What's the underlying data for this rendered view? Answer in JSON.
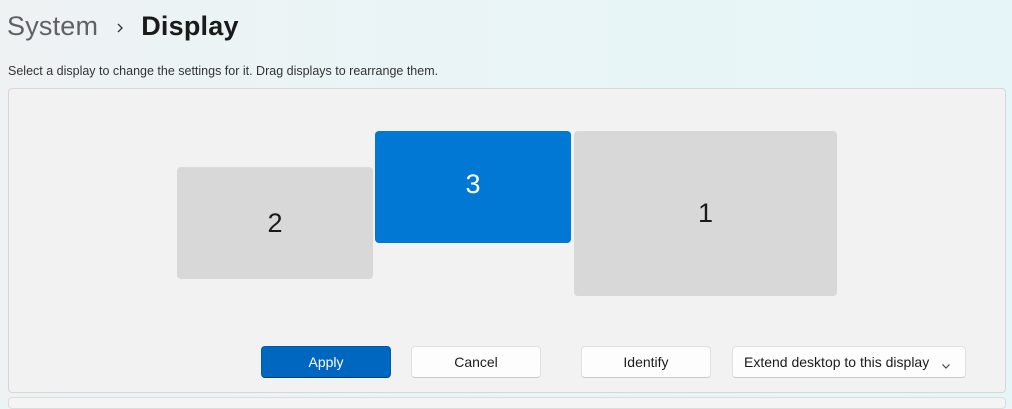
{
  "breadcrumb": {
    "parent": "System",
    "separator_icon": "chevron-right-icon",
    "current": "Display"
  },
  "instruction": "Select a display to change the settings for it. Drag displays to rearrange them.",
  "arrangement": {
    "monitors": [
      {
        "label": "2",
        "selected": false
      },
      {
        "label": "3",
        "selected": true
      },
      {
        "label": "1",
        "selected": false
      }
    ],
    "selected_color": "#0078d4",
    "unselected_color": "#d8d8d8"
  },
  "actions": {
    "apply_label": "Apply",
    "cancel_label": "Cancel",
    "identify_label": "Identify",
    "mode_select": {
      "value": "Extend desktop to this display",
      "icon": "chevron-down-icon"
    }
  },
  "accent_color": "#0067c0"
}
